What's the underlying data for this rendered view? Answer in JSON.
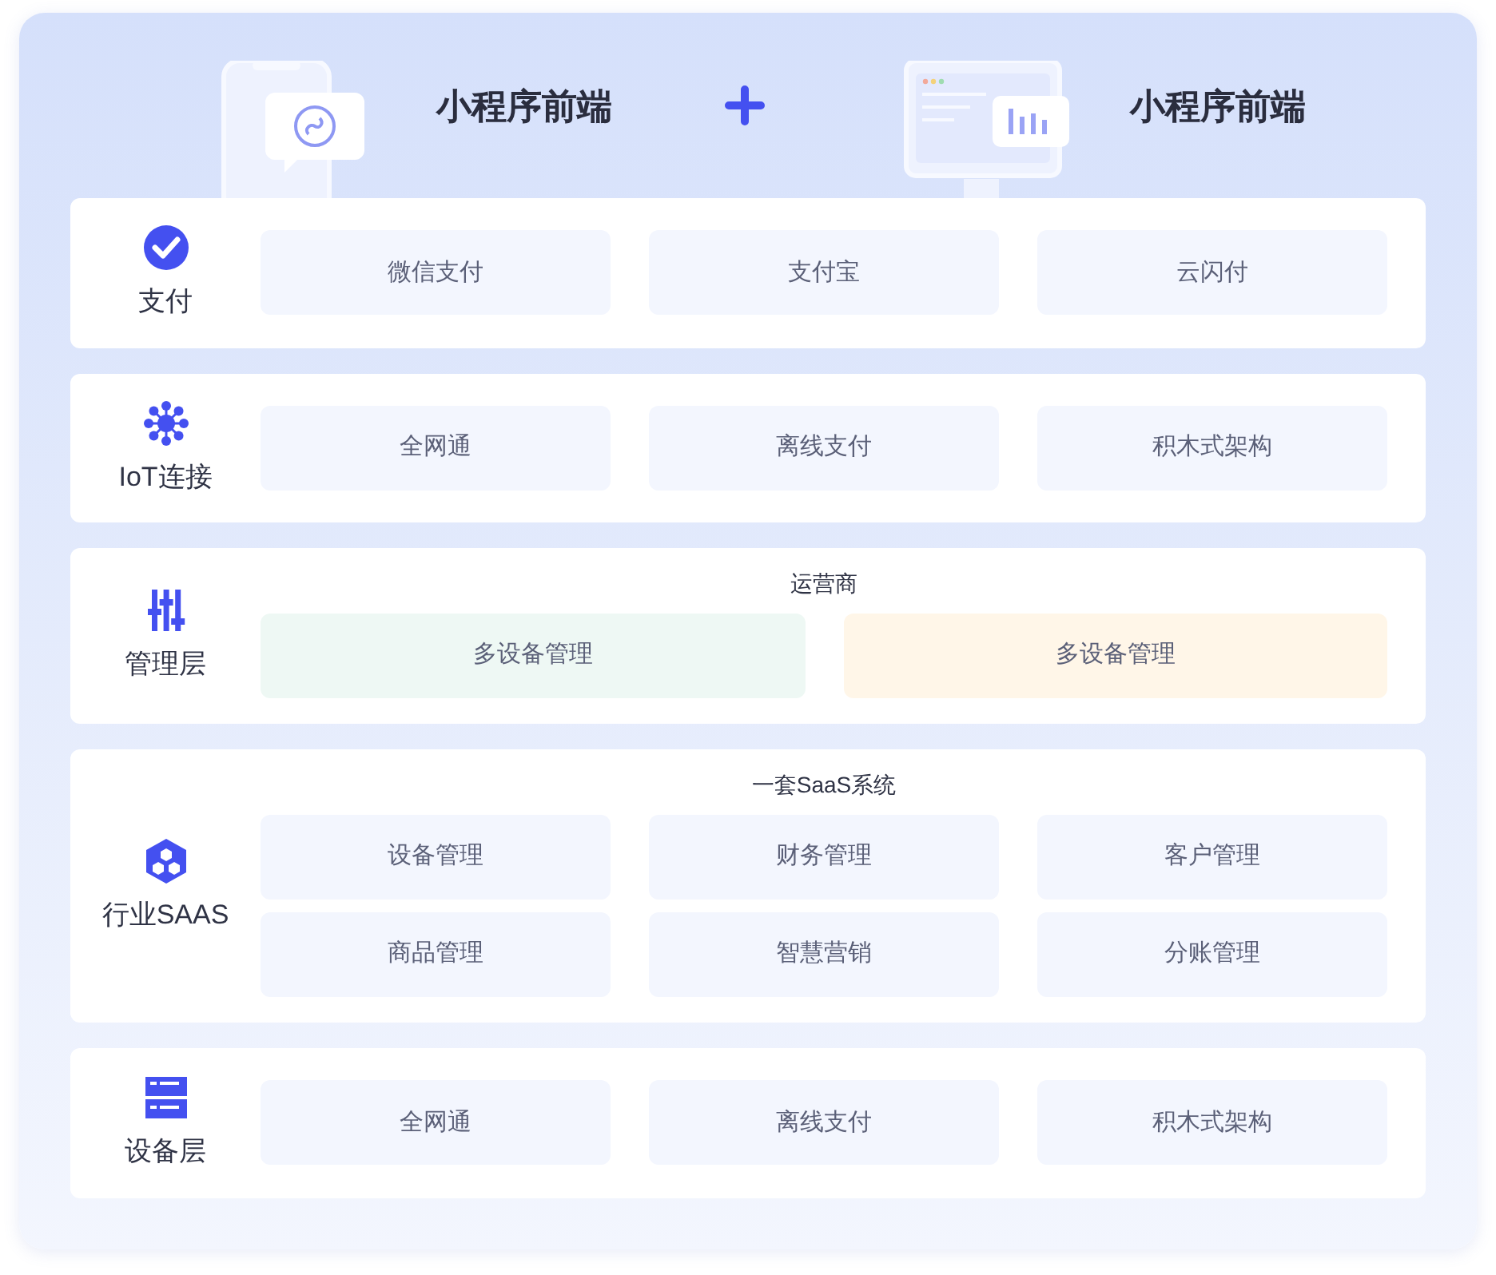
{
  "header": {
    "left_title": "小程序前端",
    "right_title": "小程序前端"
  },
  "sections": [
    {
      "label": "支付",
      "tiles": [
        {
          "label": "微信支付"
        },
        {
          "label": "支付宝"
        },
        {
          "label": "云闪付"
        }
      ]
    },
    {
      "label": "IoT连接",
      "tiles": [
        {
          "label": "全网通"
        },
        {
          "label": "离线支付"
        },
        {
          "label": "积木式架构"
        }
      ]
    },
    {
      "label": "管理层",
      "subtitle": "运营商",
      "tiles": [
        {
          "label": "多设备管理",
          "color": "#eef8f4"
        },
        {
          "label": "多设备管理",
          "color": "#fff6e8"
        }
      ]
    },
    {
      "label": "行业SAAS",
      "subtitle": "一套SaaS系统",
      "tiles": [
        {
          "label": "设备管理"
        },
        {
          "label": "财务管理"
        },
        {
          "label": "客户管理"
        },
        {
          "label": "商品管理"
        },
        {
          "label": "智慧营销"
        },
        {
          "label": "分账管理"
        }
      ]
    },
    {
      "label": "设备层",
      "tiles": [
        {
          "label": "全网通"
        },
        {
          "label": "离线支付"
        },
        {
          "label": "积木式架构"
        }
      ]
    }
  ]
}
